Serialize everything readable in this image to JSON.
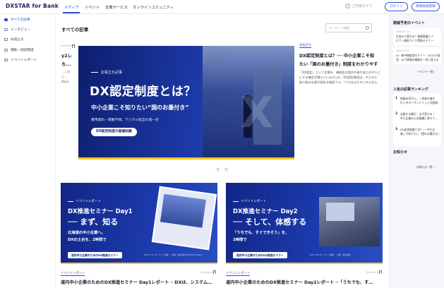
{
  "header": {
    "logo": "DXSTAR for Bank",
    "nav": [
      "メディア",
      "イベント",
      "支援サービス",
      "オンラインコミュニティ"
    ],
    "help": "ご利用ガイド",
    "login": "ログイン",
    "signup": "新規会員登録"
  },
  "sidebar": {
    "items": [
      {
        "label": "すべての記事",
        "active": true
      },
      {
        "label": "インタビュー",
        "active": false
      },
      {
        "label": "お役立ち",
        "active": false
      },
      {
        "label": "補助・助成制度",
        "active": false
      },
      {
        "label": "イベントレポート",
        "active": false
      }
    ]
  },
  "main": {
    "section_title": "すべての記事",
    "search_placeholder": "キーワード検索",
    "peek_left": {
      "date": "2024.06.20",
      "title1": "y2レ",
      "title2": "ち..."
    },
    "peek_left_body": [
      "…」の",
      "じ…",
      "Day1"
    ],
    "hero": {
      "tag": "お役立ち記事",
      "title": "DX認定制度とは？",
      "subtitle": "中小企業こそ知りたい“国のお墨付き”",
      "small": "費用無料・掲載不問。デジタル経営の第一歩",
      "pill": "DX認定制度の基礎知識",
      "bg_letter": "X"
    },
    "preview": {
      "category": "お役立ち",
      "title1": "DX認定制度とは？── 中小企業こそ知",
      "title2": "たい「国のお墨付き」制度をわかりやす",
      "body": [
        "「DX認定」という言葉を、補助金の案内や取引先とのやりと",
        "にする機会が増えていませんか。DX認定制度は、デジタル",
        "取り組みを国が認める制度です。「うちはまだデジタルなん"
      ]
    },
    "cards": [
      {
        "tag": "イベントレポート",
        "t1": "DX推進セミナー Day1",
        "t2": "── まず、知る",
        "t3": "北海道の中小企業へ。",
        "t4": "DXの土台を、2時間で",
        "pill": "道内中小企業のためのDX推進セミナー",
        "foot": "2024.7.23 オンライン開催 ・ 主催：株式会社DXSTAR for Bank",
        "category": "イベントレポート",
        "date": "2024.06.20",
        "title": "道内中小企業のためのDX推進セミナー Day1レポート ─ DXは、システム…"
      },
      {
        "tag": "イベントレポート",
        "t1": "DX推進セミナー Day2",
        "t2": "── そして、体感する",
        "t3": "「うちでも、すぐできそう」を、",
        "t4": "2時間で",
        "pill": "道内中小企業のためのDX推進セミナー",
        "foot": "2024.7.30 オンライン開催 ・ 主催：株式会社",
        "category": "イベントレポート",
        "date": "2024.06.20",
        "title": "道内中小企業のためのDX推進セミナー Day2レポート ─「うちでも、す…"
      }
    ]
  },
  "rightcol": {
    "events_title": "開催予定のイベント",
    "events": [
      {
        "date": "2024.07.10",
        "text1": "生成AIで変わる！融資稟議とア",
        "text2": "ピアン資料づくり実践セミナー"
      },
      {
        "date": "2024.07.23",
        "text1": "AI・新中期経営セミナー「2025で経",
        "text2": "営、AIで現場の業務を一気に変える"
      }
    ],
    "events_more": "イベント一覧",
    "ranking_title": "人気の記事ランキング",
    "ranking": [
      {
        "num": "1",
        "text1": "地域の声から、一本船の道を",
        "text2": "行く中小ーサンドリット北陸版…"
      },
      {
        "num": "2",
        "text1": "支援する銀行、まず変わる ─",
        "text2": "中小企業の土台整備に寄せて…"
      },
      {
        "num": "3",
        "text1": "DX認定制度とは？── 中小企",
        "text2": "業こそ知りたい「国のお墨付き」「施…"
      }
    ],
    "news_title": "お知らせ",
    "news_more": "お知らせ一覧"
  }
}
